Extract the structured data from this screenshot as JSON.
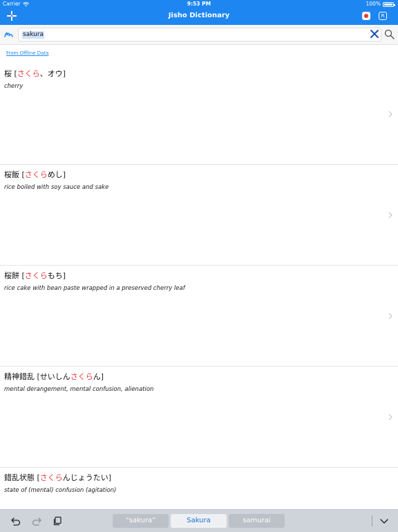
{
  "status_bar": {
    "carrier": "Carrier",
    "time": "9:53 PM",
    "battery": "100%"
  },
  "nav": {
    "title": "Jisho Dictionary",
    "r_label": "R"
  },
  "search": {
    "value": "sakura"
  },
  "source_link": "From Offline Data",
  "entries": [
    {
      "kanji": "桜",
      "reading_pre": "",
      "reading_hl": "さくら",
      "reading_post": "、オウ",
      "definition": "cherry"
    },
    {
      "kanji": "桜飯",
      "reading_pre": "",
      "reading_hl": "さくら",
      "reading_post": "めし",
      "definition": "rice boiled with soy sauce and sake"
    },
    {
      "kanji": "桜餅",
      "reading_pre": "",
      "reading_hl": "さくら",
      "reading_post": "もち",
      "definition": "rice cake with bean paste wrapped in a preserved cherry leaf"
    },
    {
      "kanji": "精神錯乱",
      "reading_pre": "せいしん",
      "reading_hl": "さくら",
      "reading_post": "ん",
      "definition": "mental derangement, mental confusion, alienation"
    },
    {
      "kanji": "錯乱状態",
      "reading_pre": "",
      "reading_hl": "さくら",
      "reading_post": "んじょうたい",
      "definition": "state of (mental) confusion (agitation)"
    }
  ],
  "keyboard_bar": {
    "suggestions": [
      "“sakura”",
      "Sakura",
      "samurai"
    ]
  },
  "colors": {
    "accent": "#1e86f0",
    "highlight": "#e33b3b"
  }
}
